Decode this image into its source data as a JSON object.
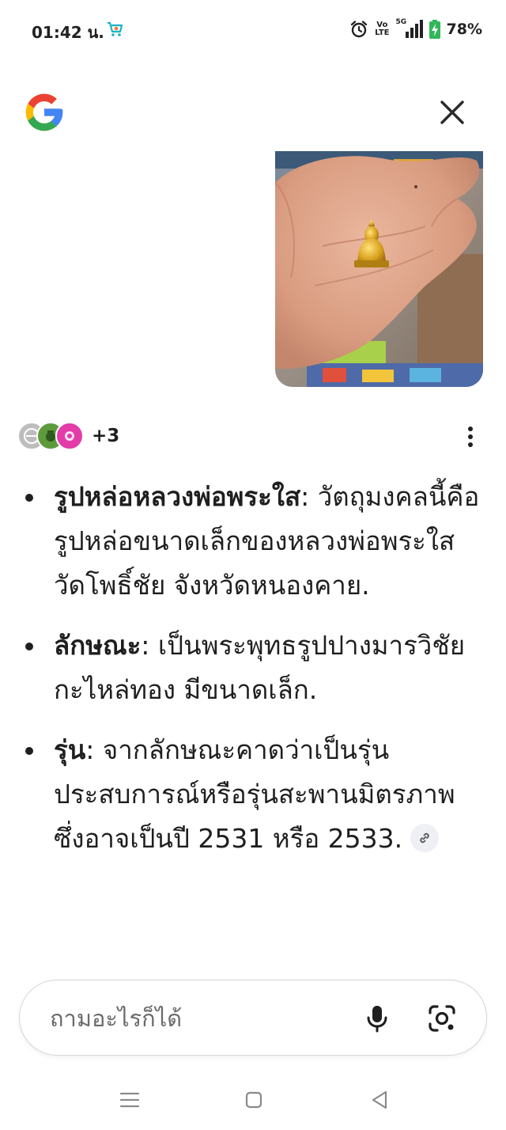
{
  "status_bar": {
    "time": "01:42 น.",
    "volte_top": "Vo",
    "volte_bottom": "LTE",
    "network": "5G",
    "battery": "78%",
    "icons": [
      "shopping-cart-icon",
      "alarm-icon",
      "volte-icon",
      "signal-icon",
      "battery-charging-icon"
    ]
  },
  "header": {
    "logo": "google-g-logo",
    "close_icon": "close-icon"
  },
  "query_image": {
    "description_icon": "photo-hand-holding-golden-amulet"
  },
  "sources": {
    "count_label": "+3",
    "menu_icon": "more-vert-icon"
  },
  "answer": {
    "items": [
      {
        "term": "รูปหล่อหลวงพ่อพระใส",
        "text": ": วัตถุมงคลนี้คือรูปหล่อขนาดเล็กของหลวงพ่อพระใส วัดโพธิ์ชัย จังหวัดหนองคาย."
      },
      {
        "term": "ลักษณะ",
        "text": ": เป็นพระพุทธรูปปางมารวิชัย กะไหล่ทอง มีขนาดเล็ก."
      },
      {
        "term": "รุ่น",
        "text": ": จากลักษณะคาดว่าเป็นรุ่นประสบการณ์หรือรุ่นสะพานมิตรภาพ ซึ่งอาจเป็นปี 2531 หรือ 2533."
      }
    ],
    "link_icon": "link-icon"
  },
  "search": {
    "placeholder": "ถามอะไรก็ได้",
    "mic_icon": "mic-icon",
    "lens_icon": "google-lens-icon"
  },
  "nav": {
    "icons": [
      "recent-apps-icon",
      "home-icon",
      "back-icon"
    ]
  },
  "colors": {
    "google_blue": "#4285F4",
    "google_red": "#EA4335",
    "google_yellow": "#FBBC05",
    "google_green": "#34A853",
    "text": "#1f1f1f",
    "battery_green": "#2fb85a"
  }
}
